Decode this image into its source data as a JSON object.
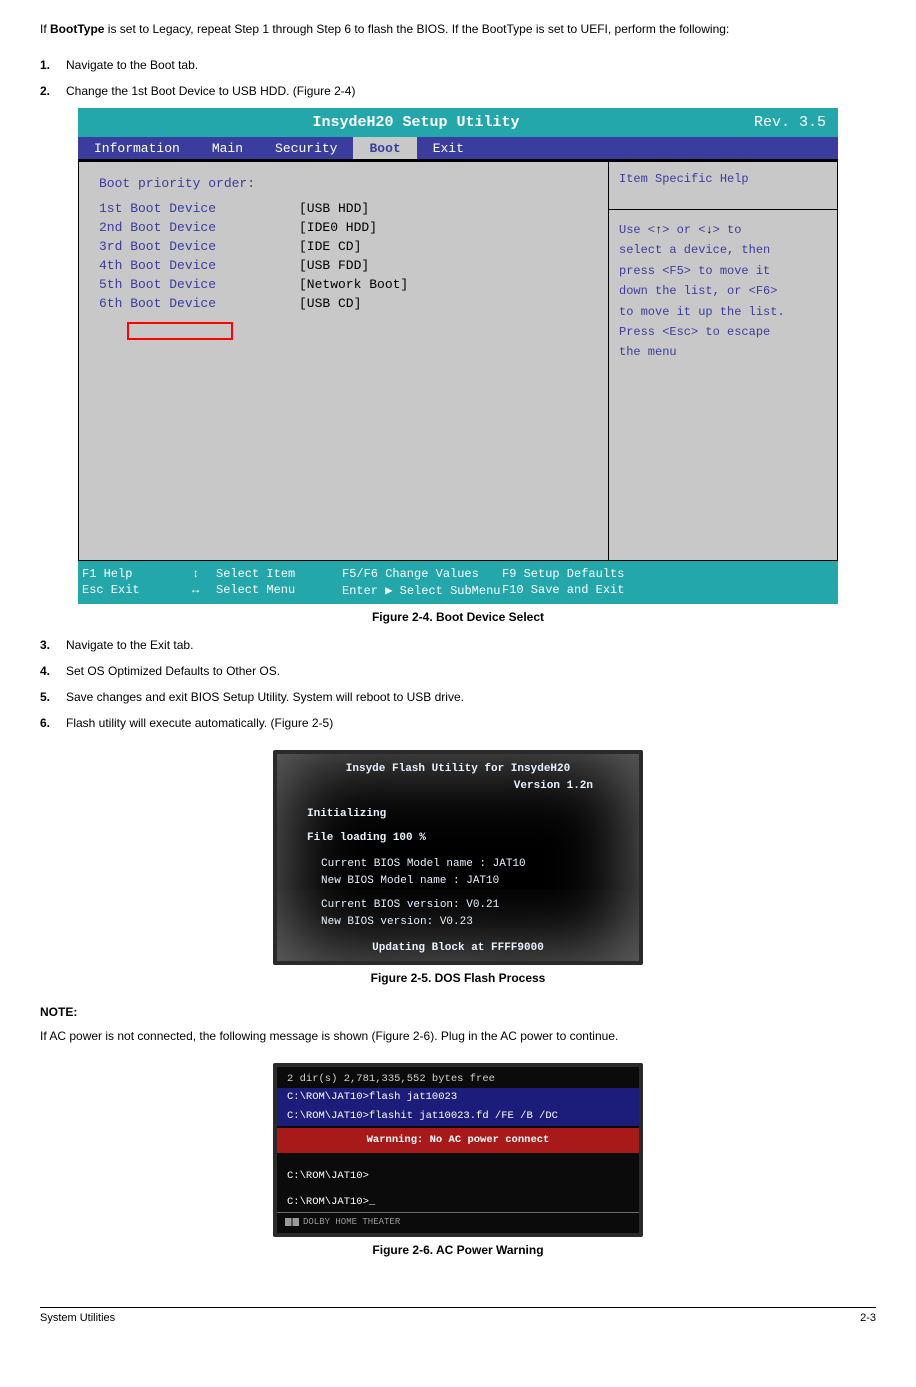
{
  "intro": {
    "text_before_bold": "If ",
    "bold": "BootType",
    "text_after_bold": " is set to Legacy, repeat Step 1 through Step 6 to flash the BIOS. If the BootType is set to UEFI, perform the following:"
  },
  "steps_a": [
    {
      "num": "1.",
      "text": "Navigate to the Boot tab."
    },
    {
      "num": "2.",
      "text": "Change the 1st Boot Device to USB HDD. (Figure 2-4)"
    }
  ],
  "bios": {
    "title": "InsydeH20 Setup Utility",
    "rev": "Rev. 3.5",
    "tabs": [
      "Information",
      "Main",
      "Security",
      "Boot",
      "Exit"
    ],
    "selected_tab": 3,
    "fields": [
      {
        "label": "Boot priority order:",
        "value": ""
      },
      {
        "label": "1st Boot Device",
        "value": "[USB HDD]"
      },
      {
        "label": "2nd Boot Device",
        "value": "[IDE0 HDD]"
      },
      {
        "label": "3rd Boot Device",
        "value": "[IDE CD]"
      },
      {
        "label": "4th Boot Device",
        "value": "[USB FDD]"
      },
      {
        "label": "5th Boot Device",
        "value": "[Network Boot]"
      },
      {
        "label": "6th Boot Device",
        "value": "[USB CD]"
      }
    ],
    "help_title": "Item Specific Help",
    "help_lines": [
      "Use <   > or <   > to",
      "select a device, then",
      "press <F5> to move it",
      "down the list, or <F6>",
      "to move it up the list.",
      "Press <Esc> to escape",
      "the menu"
    ],
    "footer": {
      "r1c1": "F1  Help",
      "r1c2": "Select Item",
      "r1c3": "F5/F6  Change Values",
      "r1c4": "F9  Setup Defaults",
      "r2c1": "Esc Exit",
      "r2c2": "Select Menu",
      "r2c3": "Enter",
      "r2c3b": "Select    SubMenu",
      "r2c4": "F10 Save and Exit"
    },
    "caption": "Figure 2-4. Boot Device Select"
  },
  "steps_b": [
    {
      "num": "3.",
      "text": "Navigate to the Exit tab."
    },
    {
      "num": "4.",
      "text": "Set OS Optimized Defaults to Other OS."
    },
    {
      "num": "5.",
      "text": "Save changes and exit BIOS Setup Utility. System will reboot to USB drive."
    },
    {
      "num": "6.",
      "text": "Flash utility will execute automatically. (Figure 2-5)"
    }
  ],
  "flash": {
    "title1": "Insyde Flash Utility for InsydeH20",
    "title2": "Version 1.2n",
    "init": "Initializing",
    "load": "File loading   100 %",
    "cur_model": "Current BIOS Model name : JAT10",
    "new_model": "New     BIOS Model name : JAT10",
    "cur_ver": "Current BIOS version: V0.21",
    "new_ver": "New     BIOS version: V0.23",
    "upd": "Updating Block at FFFF9000",
    "caption": "Figure 2-5. DOS Flash Process"
  },
  "note": {
    "label": "NOTE:",
    "body": "If AC power is not connected, the following message is shown (Figure 2-6). Plug in the AC power to continue."
  },
  "ac": {
    "top": "2 dir(s)   2,781,335,552 bytes free",
    "p1": "C:\\ROM\\JAT10>flash jat10023",
    "p2": "C:\\ROM\\JAT10>flashit jat10023.fd /FE /B /DC",
    "warn": "Warnning: No AC power connect",
    "p3": "C:\\ROM\\JAT10>",
    "p4": "C:\\ROM\\JAT10>_",
    "dolby": "DOLBY HOME THEATER",
    "caption": "Figure 2-6. AC Power Warning"
  },
  "footer": {
    "left": "System Utilities",
    "right": "2-3"
  }
}
